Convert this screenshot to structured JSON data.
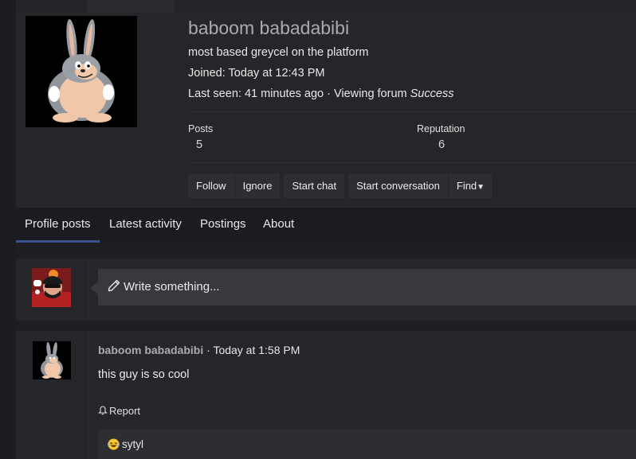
{
  "profile": {
    "username": "baboom babadabibi",
    "user_title": "most based greycel on the platform",
    "joined_label": "Joined:",
    "joined_value": "Today at 12:43 PM",
    "last_seen_label": "Last seen:",
    "last_seen_value": "41 minutes ago · Viewing forum",
    "last_seen_forum": "Success",
    "avatar_icon": "big-chungus-avatar-icon",
    "stats": [
      {
        "label": "Posts",
        "value": "5"
      },
      {
        "label": "Reputation",
        "value": "6"
      }
    ],
    "actions": {
      "follow": "Follow",
      "ignore": "Ignore",
      "start_chat": "Start chat",
      "start_conversation": "Start conversation",
      "find": "Find"
    }
  },
  "tabs": [
    {
      "label": "Profile posts",
      "active": true
    },
    {
      "label": "Latest activity",
      "active": false
    },
    {
      "label": "Postings",
      "active": false
    },
    {
      "label": "About",
      "active": false
    }
  ],
  "compose": {
    "placeholder": "Write something...",
    "icon": "pencil-icon",
    "avatar_icon": "current-user-avatar-icon"
  },
  "posts": [
    {
      "author": "baboom babadabibi",
      "separator": "·",
      "time": "Today at 1:58 PM",
      "body": "this guy is so cool",
      "report_label": "Report",
      "report_icon": "bell-icon",
      "reply": {
        "emoji_icon": "laughing-emoji-icon",
        "text": "sytyl"
      }
    }
  ],
  "colors": {
    "background": "#1e1f22",
    "panel": "#252629",
    "username": "#a9abb0",
    "active_tab_underline": "#3b5290",
    "button": "#2d2e32",
    "input": "#38393d"
  }
}
